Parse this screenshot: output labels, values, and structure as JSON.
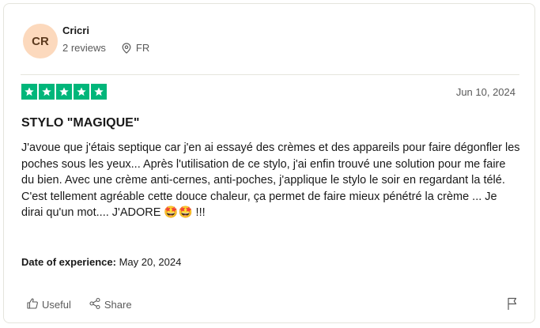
{
  "reviewer": {
    "initials": "CR",
    "name": "Cricri",
    "reviews_count": "2 reviews",
    "country": "FR"
  },
  "review": {
    "rating": 5,
    "rating_max": 5,
    "date": "Jun 10, 2024",
    "title": "STYLO \"MAGIQUE\"",
    "body": "J'avoue que j'étais septique car j'en ai essayé des crèmes et des appareils pour faire dégonfler les poches sous les yeux... Après l'utilisation de ce stylo, j'ai enfin trouvé une solution pour me faire du bien. Avec une crème anti-cernes, anti-poches, j'applique le stylo le soir en regardant la télé. C'est tellement agréable cette douce chaleur, ça permet de faire mieux pénétré la crème ... Je dirai qu'un mot.... J'ADORE 🤩🤩 !!!",
    "experience_label": "Date of experience:",
    "experience_date": "May 20, 2024"
  },
  "actions": {
    "useful_label": "Useful",
    "share_label": "Share"
  },
  "colors": {
    "star_green": "#00b67a",
    "avatar_bg": "#fcd9bd"
  },
  "icons": [
    "location-pin-icon",
    "star-icon",
    "thumbs-up-icon",
    "share-icon",
    "flag-icon"
  ]
}
